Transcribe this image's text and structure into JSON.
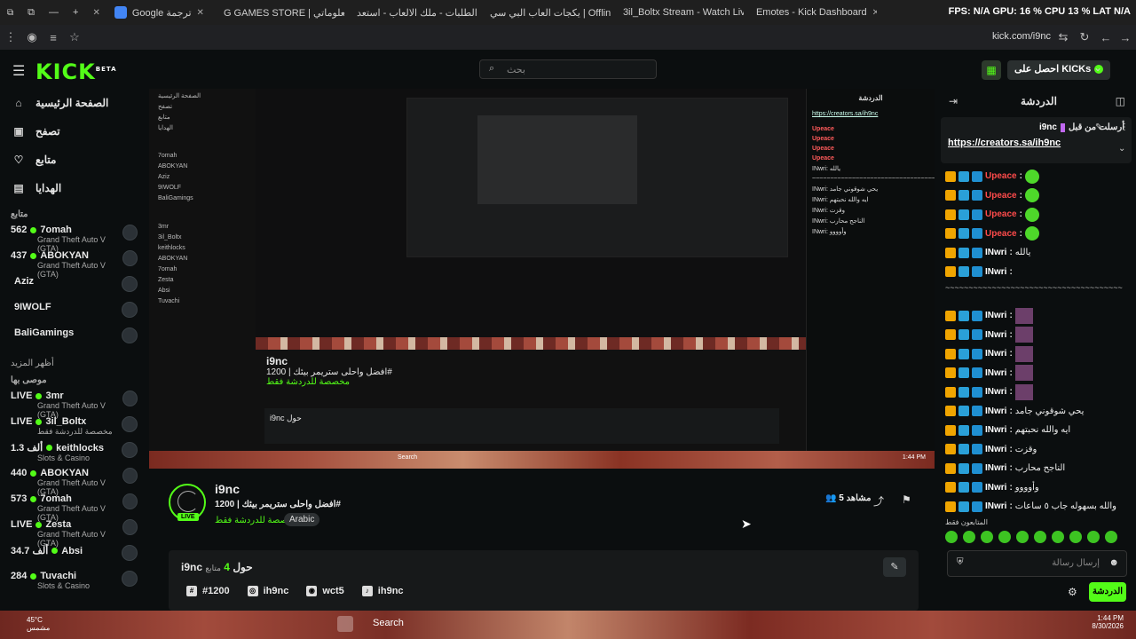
{
  "browser": {
    "tabs": [
      {
        "title": "Google ترجمة",
        "color": "#4285f4"
      },
      {
        "title": "G GAMES STORE | معلوماتي",
        "color": "#b54cd3"
      },
      {
        "title": "الطلبات - ملك الالعاب - استعد",
        "color": "#b54cd3"
      },
      {
        "title": "يكجات العاب البي سي | Offline",
        "color": "#888888"
      },
      {
        "title": "3il_Boltx Stream - Watch Live",
        "color": "#53fc18"
      },
      {
        "title": "Emotes - Kick Dashboard",
        "color": "#53fc18"
      }
    ],
    "stats": "FPS: N/A  GPU: 16 %  CPU 13 %  LAT N/A",
    "url": "kick.com/i9nc"
  },
  "header": {
    "logo": "KICK",
    "logo_sup": "BETA",
    "search_placeholder": "بحث",
    "get_kicks": "احصل على KICKs"
  },
  "sidebar": {
    "nav": [
      {
        "label": "الصفحة الرئيسية",
        "icon": "home-icon",
        "glyph": "⌂"
      },
      {
        "label": "تصفح",
        "icon": "browse-icon",
        "glyph": "▣"
      },
      {
        "label": "متابع",
        "icon": "heart-icon",
        "glyph": "♡"
      },
      {
        "label": "الهدايا",
        "icon": "gift-icon",
        "glyph": "▤"
      }
    ],
    "following_title": "متابع",
    "following": [
      {
        "num": "562",
        "name": "7omah",
        "sub": "Grand Theft Auto V (GTA)",
        "live": true
      },
      {
        "num": "437",
        "name": "ABOKYAN",
        "sub": "Grand Theft Auto V (GTA)",
        "live": true
      },
      {
        "num": "",
        "name": "Aziz",
        "sub": "",
        "live": false
      },
      {
        "num": "",
        "name": "9IWOLF",
        "sub": "",
        "live": false
      },
      {
        "num": "",
        "name": "BaliGamings",
        "sub": "",
        "live": false
      }
    ],
    "show_more": "أظهر المزيد",
    "recommended_title": "موصى بها",
    "recommended": [
      {
        "num": "LIVE",
        "name": "3mr",
        "sub": "Grand Theft Auto V (GTA)"
      },
      {
        "num": "LIVE",
        "name": "3il_Boltx",
        "sub": "مخصصة للدردشة فقط"
      },
      {
        "num": "1.3 ألف",
        "name": "keithlocks",
        "sub": "Slots & Casino"
      },
      {
        "num": "440",
        "name": "ABOKYAN",
        "sub": "Grand Theft Auto V (GTA)"
      },
      {
        "num": "573",
        "name": "7omah",
        "sub": "Grand Theft Auto V (GTA)"
      },
      {
        "num": "LIVE",
        "name": "Zesta",
        "sub": "Grand Theft Auto V (GTA)"
      },
      {
        "num": "34.7 ألف",
        "name": "Absi",
        "sub": ""
      },
      {
        "num": "284",
        "name": "Tuvachi",
        "sub": "Slots & Casino"
      }
    ]
  },
  "stream": {
    "name": "i9nc",
    "title": "افضل واحلى ستريمر بيئك | 1200#",
    "category": "مخصصة للدردشة فقط",
    "language": "Arabic",
    "live_label": "LIVE",
    "viewers": "5",
    "viewers_label": "مشاهد",
    "about_name": "i9nc حول",
    "about_count": "4",
    "about_followers": "متابع",
    "links": [
      {
        "label": "#1200",
        "icon": "hash-icon",
        "glyph": "#"
      },
      {
        "label": "ih9nc",
        "icon": "instagram-icon",
        "glyph": "◎"
      },
      {
        "label": "wct5",
        "icon": "discord-icon",
        "glyph": "◉"
      },
      {
        "label": "ih9nc",
        "icon": "tiktok-icon",
        "glyph": "♪"
      }
    ]
  },
  "chat": {
    "title": "الدردشة",
    "pinned_by": "أرسلت من قبل",
    "pinned_user": "i9nc",
    "pinned_url": "https://creators.sa/ih9nc",
    "messages": [
      {
        "user": "Upeace",
        "text": "",
        "color": "#ff4b4b",
        "emote": true
      },
      {
        "user": "Upeace",
        "text": "",
        "color": "#ff4b4b",
        "emote": true
      },
      {
        "user": "Upeace",
        "text": "",
        "color": "#ff4b4b",
        "emote": true
      },
      {
        "user": "Upeace",
        "text": "",
        "color": "#ff4b4b",
        "emote": true
      },
      {
        "user": "INwri",
        "text": "يالله",
        "color": "#ffffff",
        "emote": false
      },
      {
        "user": "INwri",
        "text": "",
        "color": "#ffffff",
        "emote": false
      }
    ],
    "dashes": "~~~~~~~~~~~~~~~~~~~~~~~~~~~~~~~~~~~~~~",
    "messages2": [
      {
        "user": "INwri",
        "text": "",
        "img": true
      },
      {
        "user": "INwri",
        "text": "",
        "img": true
      },
      {
        "user": "INwri",
        "text": "",
        "img": true
      },
      {
        "user": "INwri",
        "text": "",
        "img": true
      },
      {
        "user": "INwri",
        "text": "",
        "img": true
      },
      {
        "user": "INwri",
        "text": "يحي شوقوني جامد",
        "img": false
      },
      {
        "user": "INwri",
        "text": "ايه والله نحبتهم",
        "img": false
      },
      {
        "user": "INwri",
        "text": "وقزت",
        "img": false
      },
      {
        "user": "INwri",
        "text": "الناجح محارب",
        "img": false
      },
      {
        "user": "INwri",
        "text": "وأوووو",
        "img": false
      },
      {
        "user": "INwri",
        "text": "والله بسهوله جاب ٥ ساعات",
        "img": false
      }
    ],
    "followers_only": "المتابعون فقط",
    "input_placeholder": "إرسال رسالة",
    "send_label": "الدردشة"
  },
  "taskbar": {
    "weather_temp": "45°C",
    "weather_desc": "مشمس",
    "search_label": "Search",
    "time": "1:44 PM",
    "date": "8/30/2026"
  }
}
